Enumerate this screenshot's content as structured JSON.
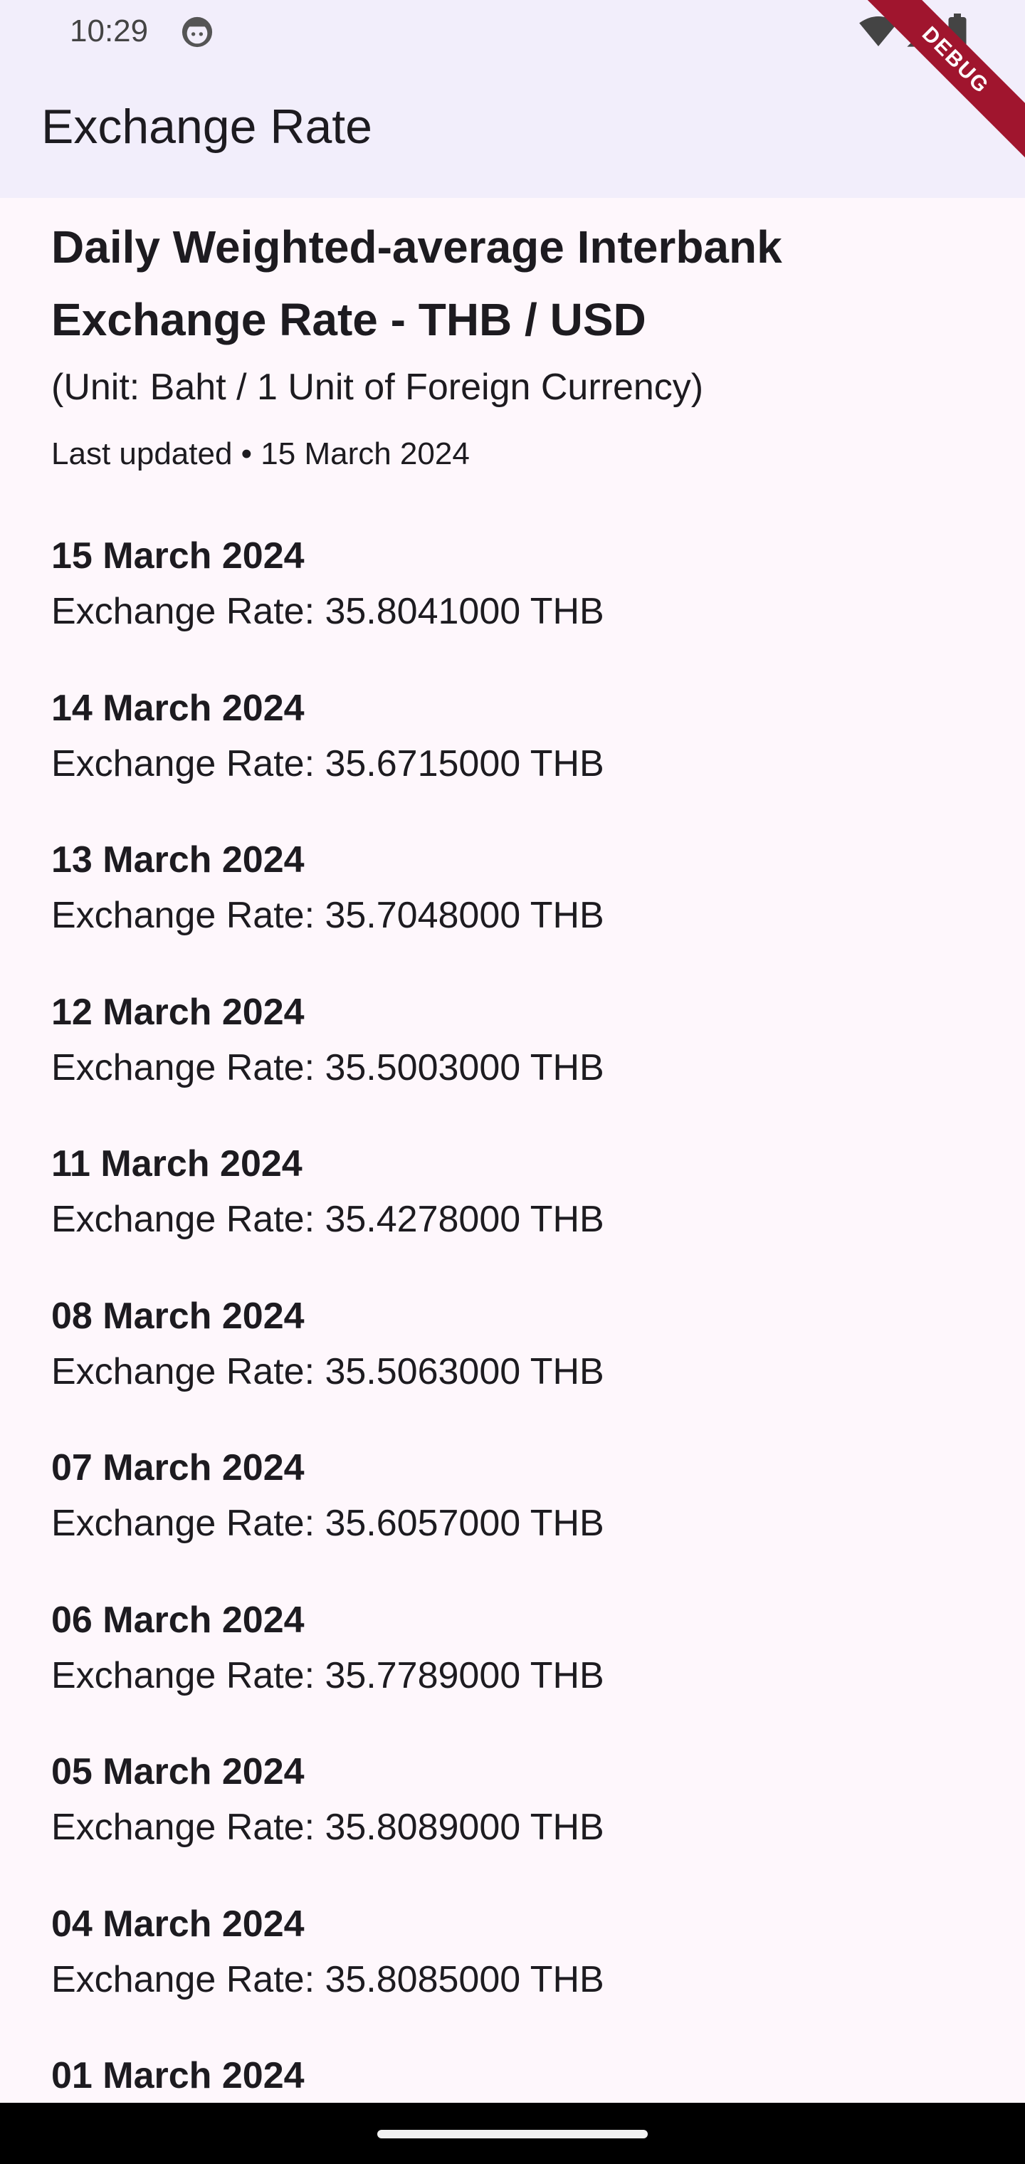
{
  "status_bar": {
    "time": "10:29"
  },
  "app_bar": {
    "title": "Exchange Rate"
  },
  "debug_banner": {
    "label": "DEBUG"
  },
  "header": {
    "title": "Daily Weighted-average Interbank Exchange Rate - THB / USD",
    "unit": "(Unit: Baht / 1 Unit of Foreign Currency)",
    "last_updated": "Last updated • 15 March 2024"
  },
  "rates": [
    {
      "date": "15 March 2024",
      "rate": "Exchange Rate: 35.8041000 THB"
    },
    {
      "date": "14 March 2024",
      "rate": "Exchange Rate: 35.6715000 THB"
    },
    {
      "date": "13 March 2024",
      "rate": "Exchange Rate: 35.7048000 THB"
    },
    {
      "date": "12 March 2024",
      "rate": "Exchange Rate: 35.5003000 THB"
    },
    {
      "date": "11 March 2024",
      "rate": "Exchange Rate: 35.4278000 THB"
    },
    {
      "date": "08 March 2024",
      "rate": "Exchange Rate: 35.5063000 THB"
    },
    {
      "date": "07 March 2024",
      "rate": "Exchange Rate: 35.6057000 THB"
    },
    {
      "date": "06 March 2024",
      "rate": "Exchange Rate: 35.7789000 THB"
    },
    {
      "date": "05 March 2024",
      "rate": "Exchange Rate: 35.8089000 THB"
    },
    {
      "date": "04 March 2024",
      "rate": "Exchange Rate: 35.8085000 THB"
    },
    {
      "date": "01 March 2024",
      "rate": ""
    }
  ],
  "icons": {
    "status_app": "android-face-icon",
    "wifi": "wifi-icon",
    "signal": "cellular-signal-icon",
    "battery": "battery-icon"
  },
  "colors": {
    "app_bar_background": "#f2eefb",
    "page_background": "#fef7fc",
    "text": "#1d1b20",
    "debug_ribbon": "#a0152e",
    "nav_bar": "#000000"
  }
}
